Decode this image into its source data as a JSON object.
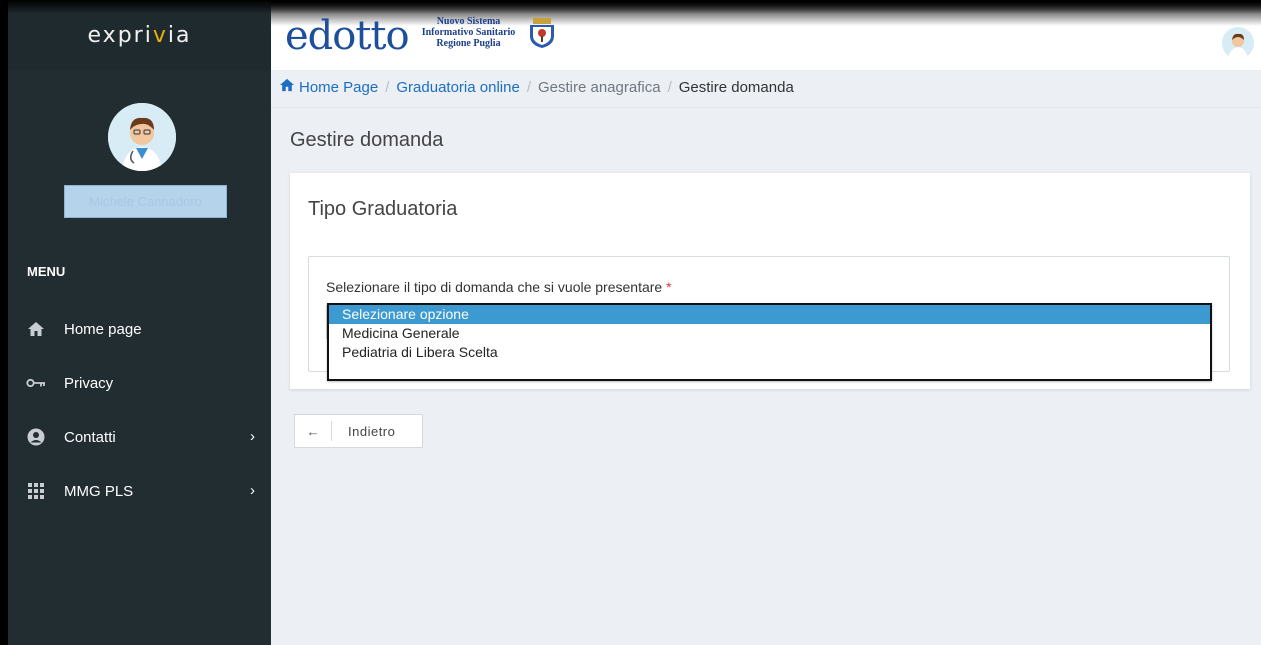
{
  "sidebar": {
    "brand": {
      "part1": "expri",
      "accent": "v",
      "part2": "ia"
    },
    "user_name": "Michele Cannadoro",
    "menu_title": "MENU",
    "items": [
      {
        "label": "Home page",
        "icon": "home-icon"
      },
      {
        "label": "Privacy",
        "icon": "key-icon"
      },
      {
        "label": "Contatti",
        "icon": "user-circle-icon",
        "arrow": "›"
      },
      {
        "label": "MMG PLS",
        "icon": "grid-icon",
        "arrow": "›"
      }
    ]
  },
  "header": {
    "logo_word": "edotto",
    "logo_sub_1": "Nuovo Sistema",
    "logo_sub_2": "Informativo Sanitario",
    "logo_sub_3": "Regione Puglia"
  },
  "breadcrumb": {
    "home": "Home Page",
    "sep": "/",
    "item2": "Graduatoria online",
    "item3": "Gestire anagrafica",
    "item4": "Gestire domanda"
  },
  "page": {
    "title": "Gestire domanda",
    "card_title": "Tipo Graduatoria",
    "field_label": "Selezionare il tipo di domanda che si vuole presentare",
    "required_mark": "*",
    "options": [
      "Selezionare opzione",
      "Medicina Generale",
      "Pediatria di Libera Scelta"
    ],
    "selected_index": 0,
    "back_arrow": "←",
    "back_label": "Indietro"
  },
  "colors": {
    "sidebar_bg": "#222d32",
    "accent_blue": "#3d9ad1",
    "link_blue": "#1b6ec2",
    "required_red": "#e3342f"
  }
}
